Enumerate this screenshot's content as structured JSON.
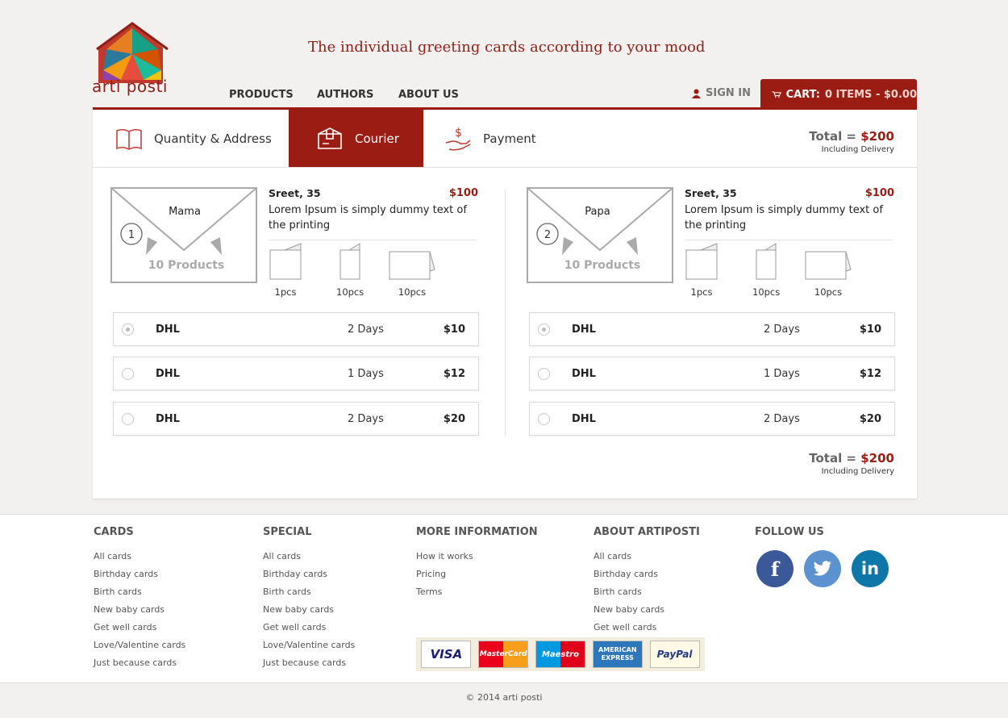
{
  "header": {
    "logo_text": "arti posti",
    "tagline": "The individual greeting cards according to your mood",
    "nav": [
      "PRODUCTS",
      "AUTHORS",
      "ABOUT US"
    ],
    "sign_in": "SIGN IN",
    "cart_label": "CART:",
    "cart_count": "0 ITEMS - $0.00"
  },
  "steps": [
    {
      "label": "Quantity & Address",
      "icon": "book-icon"
    },
    {
      "label": "Courier",
      "icon": "box-icon",
      "active": true
    },
    {
      "label": "Payment",
      "icon": "money-hand-icon"
    }
  ],
  "summary": {
    "total_label": "Total =",
    "total_value": "$200",
    "note": "Including Delivery"
  },
  "orders": [
    {
      "index": "1",
      "recipient": "Mama",
      "products": "10 Products",
      "street": "Sreet, 35",
      "price": "$100",
      "desc": "Lorem Ipsum is simply dummy text of the printing",
      "cards": [
        "1pcs",
        "10pcs",
        "10pcs"
      ],
      "couriers": [
        {
          "name": "DHL",
          "days": "2 Days",
          "price": "$10",
          "selected": true
        },
        {
          "name": "DHL",
          "days": "1 Days",
          "price": "$12",
          "selected": false
        },
        {
          "name": "DHL",
          "days": "2 Days",
          "price": "$20",
          "selected": false
        }
      ]
    },
    {
      "index": "2",
      "recipient": "Papa",
      "products": "10 Products",
      "street": "Sreet, 35",
      "price": "$100",
      "desc": "Lorem Ipsum is simply dummy text of the printing",
      "cards": [
        "1pcs",
        "10pcs",
        "10pcs"
      ],
      "couriers": [
        {
          "name": "DHL",
          "days": "2 Days",
          "price": "$10",
          "selected": true
        },
        {
          "name": "DHL",
          "days": "1 Days",
          "price": "$12",
          "selected": false
        },
        {
          "name": "DHL",
          "days": "2 Days",
          "price": "$20",
          "selected": false
        }
      ]
    }
  ],
  "footer": {
    "columns": [
      {
        "title": "CARDS",
        "links": [
          "All cards",
          "Birthday cards",
          "Birth cards",
          "New baby cards",
          "Get well cards",
          "Love/Valentine cards",
          "Just because cards"
        ]
      },
      {
        "title": "SPECIAL",
        "links": [
          "All cards",
          "Birthday cards",
          "Birth cards",
          "New baby cards",
          "Get well cards",
          "Love/Valentine cards",
          "Just because cards"
        ]
      },
      {
        "title": "MORE INFORMATION",
        "links": [
          "How it works",
          "Pricing",
          "Terms"
        ]
      },
      {
        "title": "ABOUT ARTIPOSTI",
        "links": [
          "All cards",
          "Birthday cards",
          "Birth cards",
          "New baby cards",
          "Get well cards"
        ]
      }
    ],
    "follow_title": "FOLLOW US",
    "social": [
      {
        "name": "facebook-icon",
        "glyph": "f",
        "color": "#3b5998"
      },
      {
        "name": "twitter-icon",
        "glyph": "🐦",
        "color": "#5b92cf"
      },
      {
        "name": "linkedin-icon",
        "glyph": "in",
        "color": "#0e76a8"
      }
    ],
    "payments": [
      "VISA",
      "MasterCard",
      "Maestro",
      "AMERICAN EXPRESS",
      "PayPal"
    ],
    "copyright": "© 2014 arti posti"
  },
  "colors": {
    "accent": "#9a1c13"
  }
}
